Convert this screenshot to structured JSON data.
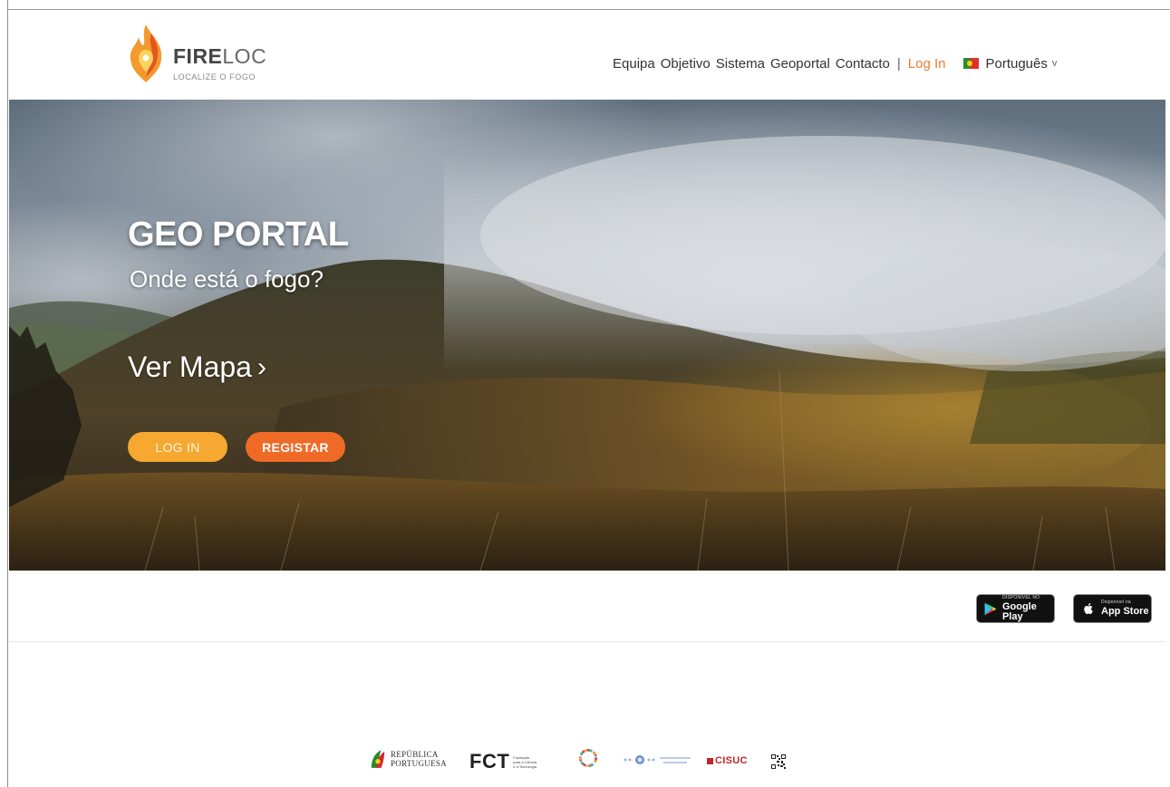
{
  "brand": {
    "name_bold": "FIRE",
    "name_light": "LOC",
    "tagline": "LOCALIZE O FOGO",
    "accent": "#ee7a2a"
  },
  "nav": {
    "items": [
      "Equipa",
      "Objetivo",
      "Sistema",
      "Geoportal",
      "Contacto"
    ],
    "separator": "|",
    "login": "Log In",
    "language": "Português",
    "language_caret": "v",
    "language_flag": "portugal-flag-icon"
  },
  "hero": {
    "title": "GEO PORTAL",
    "subtitle": "Onde está o fogo?",
    "map_link": "Ver Mapa",
    "map_chevron": "›",
    "login_button": "LOG IN",
    "register_button": "REGISTAR",
    "login_color": "#f6a830",
    "register_color": "#ef6a27"
  },
  "stores": {
    "google_small": "DISPONÍVEL NO",
    "google_big": "Google Play",
    "apple_small": "Disponível na",
    "apple_big": "App Store"
  },
  "sponsors": {
    "republica_line1": "REPÚBLICA",
    "republica_line2": "PORTUGUESA",
    "fct": "FCT",
    "fct_sub1": "Fundação",
    "fct_sub2": "para a Ciência",
    "fct_sub3": "e a Tecnologia",
    "cisuc": "CISUC"
  }
}
